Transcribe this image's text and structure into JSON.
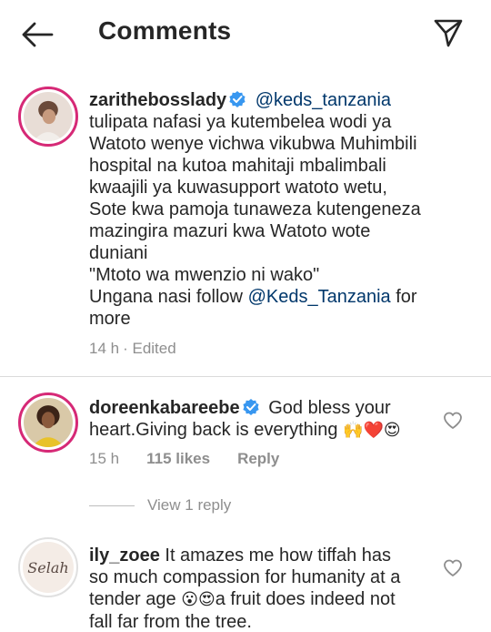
{
  "header": {
    "title": "Comments",
    "back_icon": "arrow-left-icon",
    "share_icon": "paper-plane-icon"
  },
  "comments": [
    {
      "username": "zarithebosslady",
      "verified": true,
      "mention": "@keds_tanzania",
      "body_lines": [
        "tulipata nafasi ya kutembelea wodi ya",
        "Watoto wenye vichwa vikubwa Muhimbili",
        "hospital na kutoa mahitaji mbalimbali",
        "kwaajili ya kuwasupport watoto wetu,",
        "Sote kwa pamoja tunaweza kutengeneza",
        "mazingira mazuri kwa Watoto wote",
        "duniani",
        "\"Mtoto wa mwenzio ni wako\""
      ],
      "follow_prefix": "Ungana nasi follow ",
      "follow_mention": "@Keds_Tanzania",
      "follow_suffix": " for",
      "last_line": "more",
      "time": "14 h",
      "edited": "· Edited"
    },
    {
      "username": "doreenkabareebe",
      "verified": true,
      "text_line1": "God bless your",
      "text_line2": "heart.Giving back is everything",
      "emojis": "🙌❤️😍",
      "time": "15 h",
      "likes": "115 likes",
      "reply": "Reply",
      "view_replies": "View 1 reply"
    },
    {
      "username": "ily_zoee",
      "avatar_text": "Selah",
      "text_line1": "It amazes me how tiffah has",
      "text_line2": "so much compassion for humanity at a",
      "text_line3_prefix": "tender age",
      "text_line3_emojis": "😮😍",
      "text_line3_suffix": "a fruit does indeed not",
      "text_line4": "fall far from the tree."
    }
  ],
  "colors": {
    "text": "#262626",
    "muted": "#8e8e8e",
    "mention": "#00376b",
    "verified": "#3897f0",
    "divider": "#dbdbdb"
  }
}
